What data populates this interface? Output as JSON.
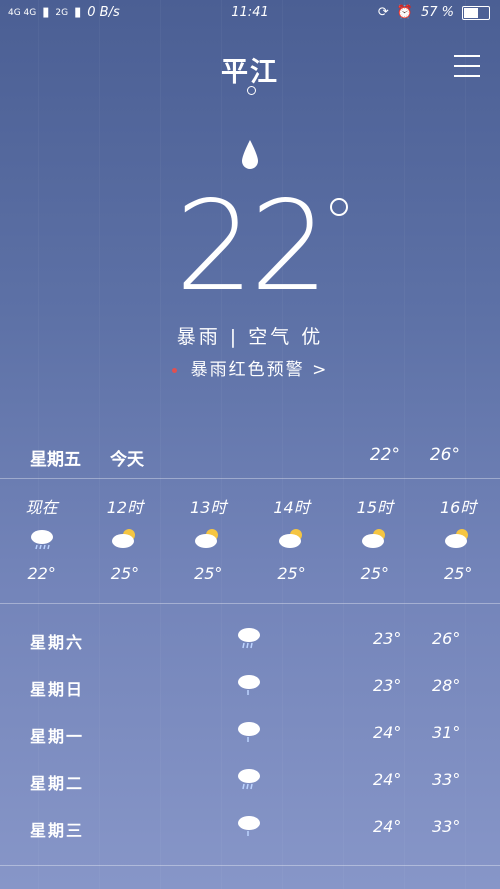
{
  "status_bar": {
    "network": "4G 4G",
    "network2": "2G",
    "speed": "0 B/s",
    "time": "11:41",
    "battery": "57 %"
  },
  "city": "平江",
  "current": {
    "temperature": "22",
    "condition": "暴雨 | 空气 优",
    "alert": "暴雨红色预警 >"
  },
  "today": {
    "day": "星期五",
    "label": "今天",
    "low": "22°",
    "high": "26°"
  },
  "hourly": [
    {
      "time": "现在",
      "icon": "rain-cloud",
      "temp": "22°"
    },
    {
      "time": "12时",
      "icon": "partly-cloudy",
      "temp": "25°"
    },
    {
      "time": "13时",
      "icon": "partly-cloudy",
      "temp": "25°"
    },
    {
      "time": "14时",
      "icon": "partly-cloudy",
      "temp": "25°"
    },
    {
      "time": "15时",
      "icon": "partly-cloudy",
      "temp": "25°"
    },
    {
      "time": "16时",
      "icon": "partly-cloudy",
      "temp": "25°"
    }
  ],
  "daily": [
    {
      "day": "星期六",
      "icon": "heavy-rain-cloud",
      "low": "23°",
      "high": "26°"
    },
    {
      "day": "星期日",
      "icon": "light-rain-cloud",
      "low": "23°",
      "high": "28°"
    },
    {
      "day": "星期一",
      "icon": "light-rain-cloud",
      "low": "24°",
      "high": "31°"
    },
    {
      "day": "星期二",
      "icon": "heavy-rain-cloud",
      "low": "24°",
      "high": "33°"
    },
    {
      "day": "星期三",
      "icon": "light-rain-cloud",
      "low": "24°",
      "high": "33°"
    }
  ],
  "colors": {
    "bg_top": "#4b5f94",
    "bg_bottom": "#8796c8",
    "alert_dot": "#e05050",
    "sun": "#f5c542"
  }
}
